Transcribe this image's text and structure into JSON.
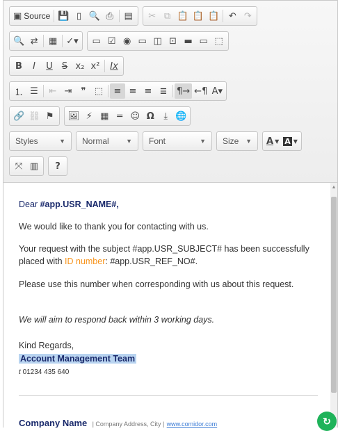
{
  "toolbar": {
    "row1": {
      "source_label": "Source",
      "icons": [
        "save-icon",
        "new-page-icon",
        "preview-icon",
        "print-icon",
        "templates-icon",
        "cut-icon",
        "copy-icon",
        "paste-icon",
        "paste-text-icon",
        "paste-word-icon",
        "undo-icon",
        "redo-icon"
      ]
    },
    "row2": {
      "icons": [
        "find-icon",
        "replace-icon",
        "select-all-icon",
        "spellcheck-icon",
        "form-icon",
        "checkbox-icon",
        "radio-icon",
        "text-field-icon",
        "textarea-icon",
        "select-icon",
        "button-icon",
        "image-button-icon",
        "hidden-field-icon"
      ]
    },
    "row3": {
      "bold": "B",
      "italic": "I",
      "underline": "U",
      "strike": "S",
      "subscript": "x₂",
      "superscript": "x²",
      "remove_format": "Ix"
    },
    "row5": {
      "omega": "Ω"
    },
    "row6": {
      "styles": "Styles",
      "format": "Normal",
      "font": "Font",
      "size": "Size",
      "text_color": "A",
      "bg_color": "A"
    },
    "row7": {
      "help": "?"
    }
  },
  "content": {
    "greeting_prefix": "Dear ",
    "greeting_name": "#app.USR_NAME#,",
    "thanks": "We would like to thank you for contacting with us.",
    "request_1": "Your request with the subject #app.USR_SUBJECT# has been successfully placed with ",
    "id_label": "ID number",
    "request_2": ": #app.USR_REF_NO#.",
    "use_number": "Please use this number when corresponding with us about this request.",
    "aim": "We will aim to respond back within 3 working days.",
    "kind_regards": "Kind Regards,",
    "team": "Account Management Team",
    "phone_prefix": "t ",
    "phone": "01234 435 640",
    "company_name": "Company Name",
    "company_address": "| Company Address, City |",
    "website": "www.comidor.com"
  },
  "colors": {
    "accent_orange": "#f7941d",
    "navy": "#1a2a6c",
    "highlight": "#b9d4f0",
    "fab": "#1fb35a"
  }
}
